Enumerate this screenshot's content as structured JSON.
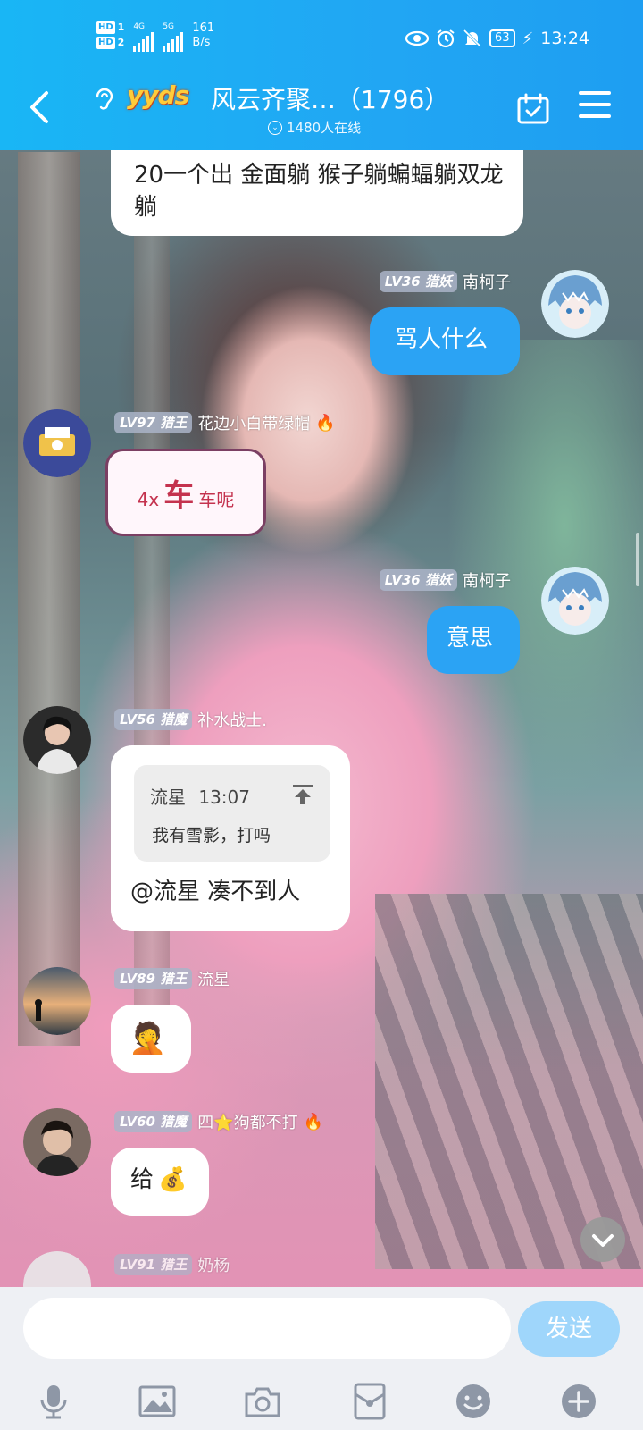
{
  "status_bar": {
    "hd1": "HD",
    "hd1_num": "1",
    "hd2": "HD",
    "hd2_num": "2",
    "net1": "4G",
    "net2": "5G",
    "speed_value": "161",
    "speed_unit": "B/s",
    "battery": "63",
    "time": "13:24"
  },
  "header": {
    "logo_text": "yyds",
    "title": "风云齐聚…（1796）",
    "online": "1480人在线"
  },
  "messages": [
    {
      "type": "partial",
      "text": "20一个出 金面躺 猴子躺蝙蝠躺双龙躺"
    },
    {
      "type": "mine",
      "level": "LV36",
      "rank": "猎妖",
      "user": "南柯子",
      "text": "骂人什么"
    },
    {
      "type": "theirs",
      "level": "LV97",
      "rank": "猎王",
      "user": "花边小白带绿帽",
      "sticker_text": "4x车车呢",
      "sticker_big": "车",
      "sticker_pre": "4x",
      "sticker_post": "车呢"
    },
    {
      "type": "mine",
      "level": "LV36",
      "rank": "猎妖",
      "user": "南柯子",
      "text": "意思"
    },
    {
      "type": "theirs",
      "level": "LV56",
      "rank": "猎魔",
      "user": "补水战士.",
      "quote_user": "流星",
      "quote_time": "13:07",
      "quote_text": "我有雪影，打吗",
      "text": "@流星 凑不到人"
    },
    {
      "type": "theirs",
      "level": "LV89",
      "rank": "猎王",
      "user": "流星",
      "emoji": "🤦"
    },
    {
      "type": "theirs",
      "level": "LV60",
      "rank": "猎魔",
      "user": "四⭐狗都不打",
      "text": "给",
      "emoji": "💰"
    },
    {
      "type": "partial",
      "level": "LV91",
      "rank": "猎王",
      "user": "奶杨"
    }
  ],
  "input": {
    "placeholder": "",
    "send_label": "发送"
  },
  "toolbar": [
    "mic-icon",
    "image-icon",
    "camera-icon",
    "red-packet-icon",
    "emoji-icon",
    "plus-icon"
  ],
  "colors": {
    "header": "#1eaaf4",
    "my_bubble": "#2ba3f4",
    "send": "#9fd6fb"
  }
}
